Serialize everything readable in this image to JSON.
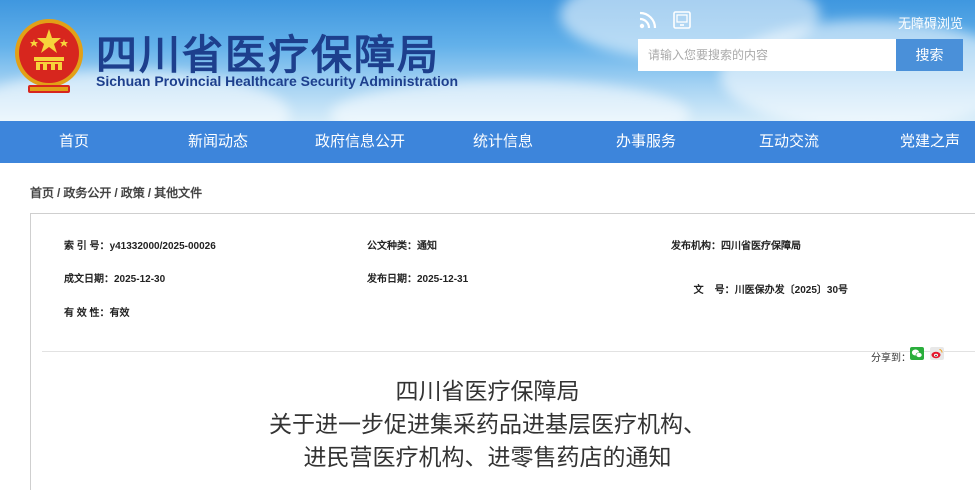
{
  "header": {
    "site_title": "四川省医疗保障局",
    "site_subtitle": "Sichuan Provincial Healthcare Security Administration",
    "accessibility_label": "无障碍浏览",
    "search_placeholder": "请输入您要搜索的内容",
    "search_button": "搜索",
    "icons": [
      "emblem-icon",
      "rss-icon",
      "mobile-icon"
    ]
  },
  "nav": {
    "items": [
      {
        "label": "首页"
      },
      {
        "label": "新闻动态"
      },
      {
        "label": "政府信息公开"
      },
      {
        "label": "统计信息"
      },
      {
        "label": "办事服务"
      },
      {
        "label": "互动交流"
      },
      {
        "label": "党建之声"
      }
    ]
  },
  "breadcrumb": {
    "items": [
      "首页",
      "政务公开",
      "政策",
      "其他文件"
    ],
    "separator": "/"
  },
  "meta": {
    "index_label": "索 引 号：",
    "index_value": "y41332000/2025-00026",
    "category_label": "公文种类：",
    "category_value": "通知",
    "issuer_label": "发布机构：",
    "issuer_value": "四川省医疗保障局",
    "created_label": "成文日期：",
    "created_value": "2025-12-30",
    "published_label": "发布日期：",
    "published_value": "2025-12-31",
    "docno_label": "文    号：",
    "docno_value": "川医保办发〔2025〕30号",
    "validity_label": "有 效 性：",
    "validity_value": "有效"
  },
  "share": {
    "label": "分享到：",
    "icons": [
      "wechat-icon",
      "weibo-icon"
    ]
  },
  "article": {
    "title_lines": [
      "四川省医疗保障局",
      "关于进一步促进集采药品进基层医疗机构、",
      "进民营医疗机构、进零售药店的通知"
    ]
  },
  "colors": {
    "nav_bg": "#3d85db",
    "title_blue": "#1d3f8d",
    "search_button": "#4a90d9"
  }
}
